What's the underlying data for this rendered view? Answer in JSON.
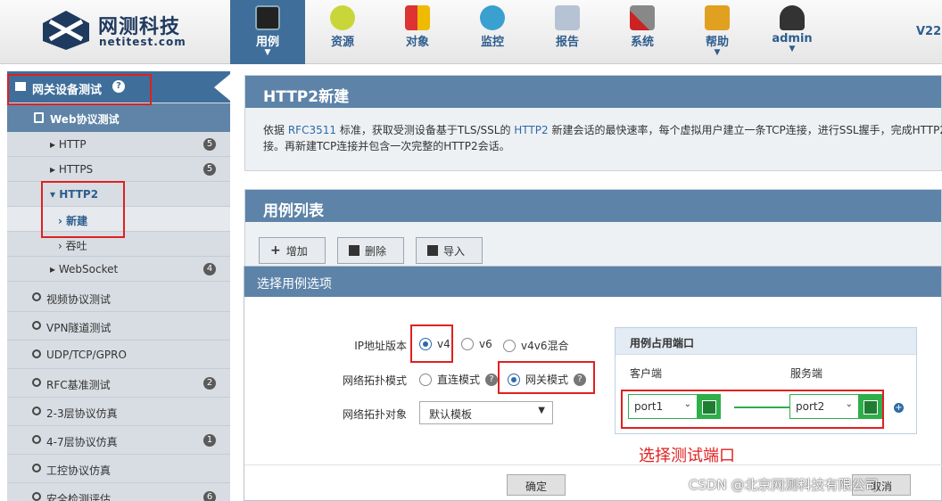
{
  "brand": {
    "name": "网测科技",
    "sub": "netitest.com"
  },
  "nav": [
    {
      "label": "用例",
      "active": true,
      "caret": true,
      "icon": "monitor-icon"
    },
    {
      "label": "资源",
      "active": false,
      "caret": false,
      "icon": "database-icon"
    },
    {
      "label": "对象",
      "active": false,
      "caret": false,
      "icon": "objects-icon"
    },
    {
      "label": "监控",
      "active": false,
      "caret": false,
      "icon": "monitor-globe-icon"
    },
    {
      "label": "报告",
      "active": false,
      "caret": false,
      "icon": "report-icon"
    },
    {
      "label": "系统",
      "active": false,
      "caret": false,
      "icon": "tools-icon"
    },
    {
      "label": "帮助",
      "active": false,
      "caret": true,
      "icon": "folder-icon"
    },
    {
      "label": "admin",
      "active": false,
      "caret": true,
      "icon": "user-icon"
    }
  ],
  "version": "V22.",
  "sidebar": {
    "header": "网关设备测试",
    "sub": "Web协议测试",
    "items": [
      {
        "label": "HTTP",
        "badge": "5"
      },
      {
        "label": "HTTPS",
        "badge": "5"
      },
      {
        "label": "HTTP2",
        "badge": ""
      },
      {
        "label": "新建",
        "badge": ""
      },
      {
        "label": "吞吐",
        "badge": ""
      },
      {
        "label": "WebSocket",
        "badge": "4"
      },
      {
        "label": "视频协议测试",
        "badge": ""
      },
      {
        "label": "VPN隧道测试",
        "badge": ""
      },
      {
        "label": "UDP/TCP/GPRO",
        "badge": ""
      },
      {
        "label": "RFC基准测试",
        "badge": "2"
      },
      {
        "label": "2-3层协议仿真",
        "badge": ""
      },
      {
        "label": "4-7层协议仿真",
        "badge": "1"
      },
      {
        "label": "工控协议仿真",
        "badge": ""
      },
      {
        "label": "安全检测评估",
        "badge": "6"
      }
    ]
  },
  "page": {
    "title": "HTTP2新建",
    "desc_1": "依据",
    "desc_rfc": "RFC3511",
    "desc_2": "标准，获取受测设备基于TLS/SSL的",
    "desc_http2": "HTTP2",
    "desc_3": "新建会话的最快速率，每个虚拟用户建立一条TCP连接，进行SSL握手，完成HTTP2",
    "desc_4": "接。再新建TCP连接并包含一次完整的HTTP2会话。"
  },
  "caselist": {
    "title": "用例列表",
    "add": "增加",
    "delete": "删除",
    "import": "导入"
  },
  "modal": {
    "title": "选择用例选项",
    "ip_label": "IP地址版本",
    "ip_v4": "v4",
    "ip_v6": "v6",
    "ip_mixed": "v4v6混合",
    "topo_label": "网络拓扑模式",
    "topo_direct": "直连模式",
    "topo_gateway": "网关模式",
    "obj_label": "网络拓扑对象",
    "obj_value": "默认模板",
    "ports_title": "用例占用端口",
    "client": "客户端",
    "server": "服务端",
    "port1": "port1",
    "port2": "port2",
    "ok": "确定",
    "cancel": "取消"
  },
  "annotation": "选择测试端口",
  "watermark": "CSDN @北京网测科技有限公司",
  "colors": {
    "accent": "#5d83a8",
    "nav_active": "#3f6e9a",
    "highlight": "#e02020",
    "port_green": "#2fae4a"
  }
}
